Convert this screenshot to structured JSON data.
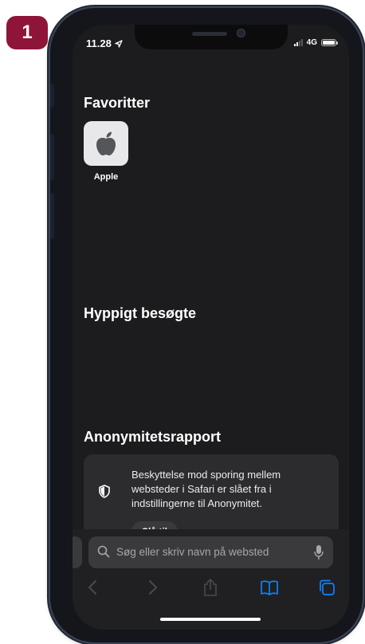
{
  "step_number": "1",
  "status_bar": {
    "time": "11.28",
    "network": "4G"
  },
  "favorites": {
    "title": "Favoritter",
    "items": [
      {
        "label": "Apple",
        "icon": "apple-icon"
      }
    ]
  },
  "frequently_visited": {
    "title": "Hyppigt besøgte"
  },
  "privacy_report": {
    "title": "Anonymitetsrapport",
    "message": "Beskyttelse mod sporing mellem websteder i Safari er slået fra i indstillingerne til Anonymitet.",
    "button_label": "Slå til"
  },
  "search": {
    "placeholder": "Søg eller skriv navn på websted"
  },
  "toolbar": [
    "back-icon",
    "forward-icon",
    "share-icon",
    "bookmarks-icon",
    "tabs-icon"
  ],
  "colors": {
    "badge": "#8e1538",
    "accent": "#0a84ff",
    "background": "#1c1c1e"
  }
}
